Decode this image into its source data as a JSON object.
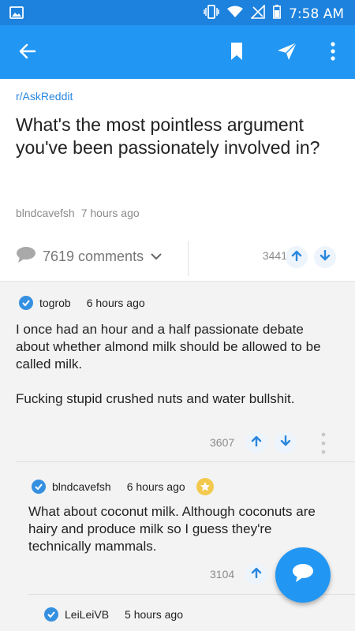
{
  "status_bar": {
    "time": "7:58 AM"
  },
  "app_bar": {
    "back_icon": "arrow-left-icon",
    "bookmark_icon": "bookmark-icon",
    "share_icon": "send-icon",
    "menu_icon": "more-vert-icon"
  },
  "post": {
    "subreddit": "r/AskReddit",
    "title": "What's the most pointless argument you've been passionately involved in?",
    "author": "blndcavefsh",
    "age": "7 hours ago",
    "comments_label": "7619 comments",
    "score": "3441"
  },
  "comments": [
    {
      "author": "togrob",
      "age": "6 hours ago",
      "body": "I once had an hour and a half passionate debate about whether almond milk should be allowed to be called milk.\n\nFucking stupid crushed nuts and water bullshit.",
      "score": "3607"
    },
    {
      "author": "blndcavefsh",
      "age": "6 hours ago",
      "body": "What about coconut milk. Although coconuts are hairy and produce milk so I guess they're technically mammals.",
      "score": "3104",
      "award_icon": "star-award-icon"
    },
    {
      "author": "LeiLeiVB",
      "age": "5 hours ago"
    }
  ],
  "colors": {
    "app_bar": "#2196f3",
    "status_bar": "#1c82dd",
    "accent": "#2a87dd",
    "comments_bg": "#f3f3f3"
  }
}
